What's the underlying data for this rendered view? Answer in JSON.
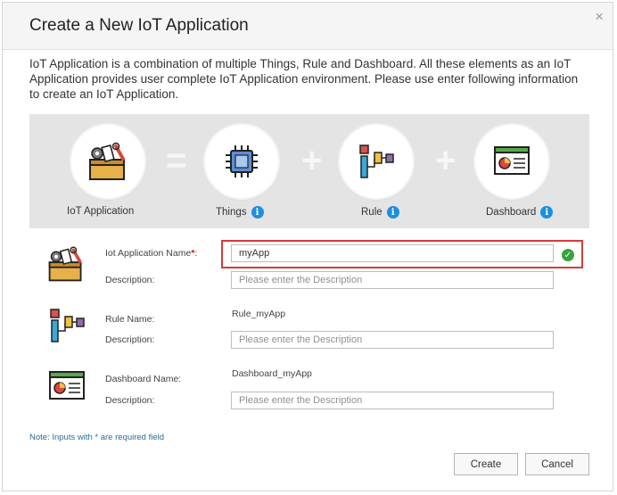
{
  "dialog": {
    "title": "Create a New IoT Application",
    "close_glyph": "×",
    "intro": "IoT Application is a combination of multiple Things, Rule and Dashboard. All these elements as an IoT Application provides user complete IoT Application environment. Please use enter following information to create an IoT Application."
  },
  "banner": {
    "items": [
      {
        "label": "IoT Application",
        "icon": "toolbox-icon",
        "info": false
      },
      {
        "label": "Things",
        "icon": "chip-icon",
        "info": true
      },
      {
        "label": "Rule",
        "icon": "rule-icon",
        "info": true
      },
      {
        "label": "Dashboard",
        "icon": "dashboard-icon",
        "info": true
      }
    ],
    "operators": [
      "=",
      "+",
      "+"
    ],
    "info_glyph": "i"
  },
  "form": {
    "app_name_label": "Iot Application Name",
    "required_mark": "*",
    "label_colon": ":",
    "app_name_value": "myApp",
    "description_label": "Description:",
    "description_placeholder": "Please enter the Description",
    "rule_name_label": "Rule Name:",
    "rule_name_value": "Rule_myApp",
    "dashboard_name_label": "Dashboard Name:",
    "dashboard_name_value": "Dashboard_myApp",
    "valid_glyph": "✓"
  },
  "note": "Note: Inputs with * are required field",
  "buttons": {
    "create": "Create",
    "cancel": "Cancel"
  },
  "colors": {
    "accent": "#1b8fe0",
    "error_border": "#d83a3a",
    "valid": "#3aa33a",
    "required": "#d01616"
  }
}
